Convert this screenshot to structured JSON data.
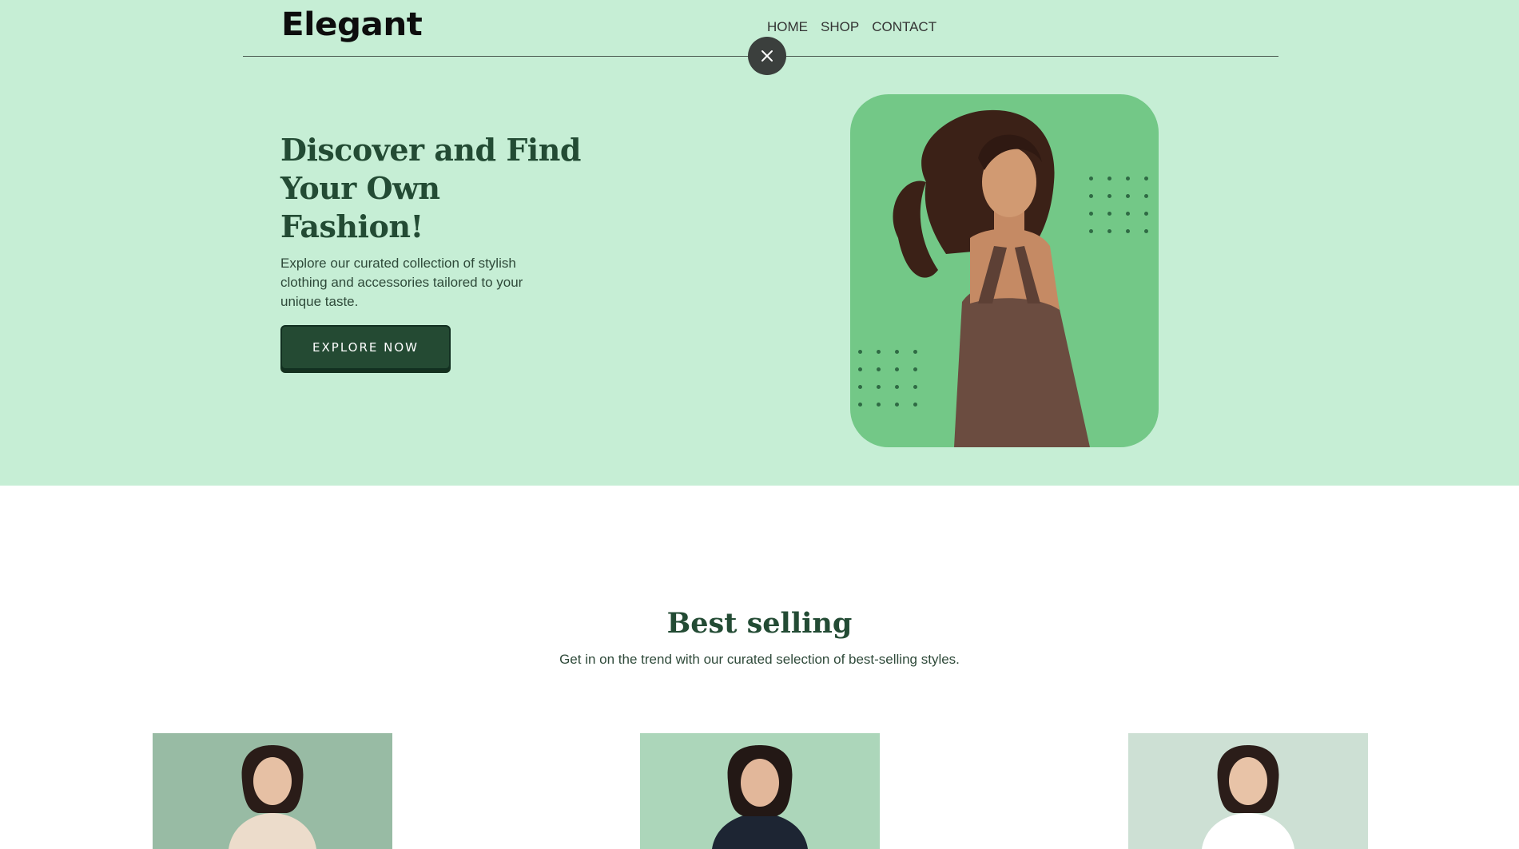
{
  "brand": {
    "logo": "Elegant"
  },
  "nav": {
    "items": [
      "HOME",
      "SHOP",
      "CONTACT"
    ]
  },
  "hero": {
    "title": "Discover and Find Your Own Fashion!",
    "description": "Explore our curated collection of stylish clothing and accessories tailored to your unique taste.",
    "cta_label": "EXPLORE NOW"
  },
  "best_selling": {
    "title": "Best selling",
    "subtitle": "Get in on the trend with our curated selection of best-selling styles."
  },
  "colors": {
    "hero_bg": "#c6eed5",
    "accent_dark_green": "#244a33",
    "card_green": "#73c887",
    "product_bg_1": "#98bba4",
    "product_bg_2": "#acd6ba",
    "product_bg_3": "#cde0d4"
  },
  "icons": {
    "close": "close-icon"
  }
}
